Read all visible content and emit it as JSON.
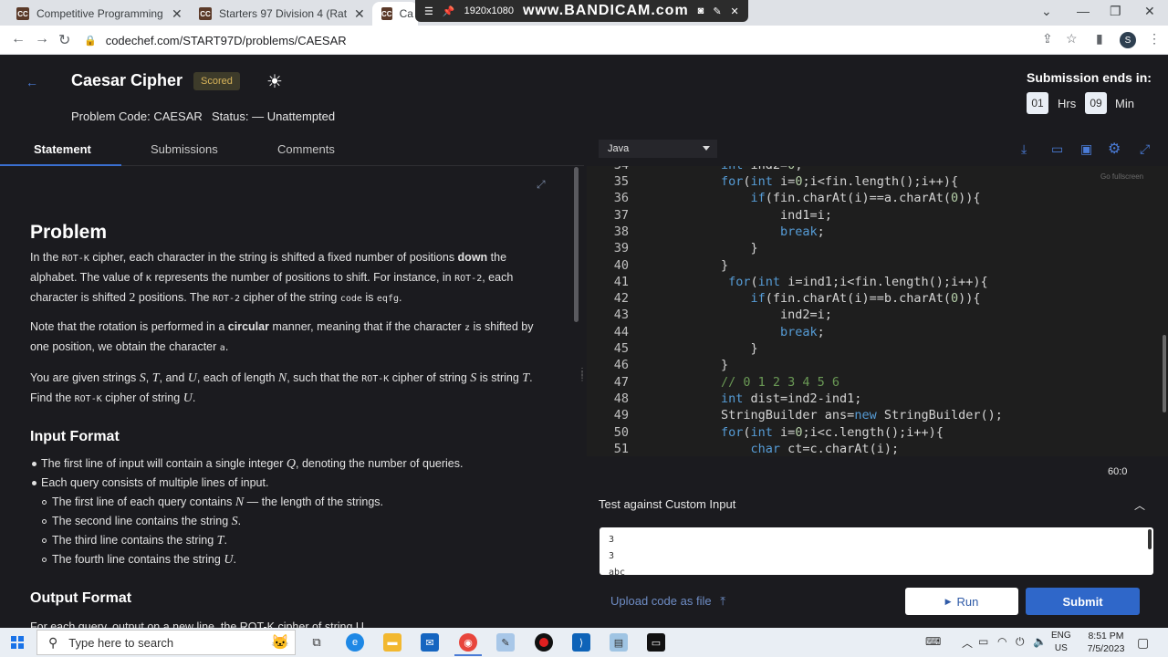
{
  "browser": {
    "tabs": [
      {
        "favicon": "CC",
        "title": "Competitive Programming and C",
        "close": "✕"
      },
      {
        "favicon": "CC",
        "title": "Starters 97 Division 4 (Rated) Co",
        "close": "✕"
      },
      {
        "favicon": "CC",
        "title": "Ca",
        "close": ""
      }
    ],
    "recorder": {
      "resolution": "1920x1080",
      "brand": "www.BANDICAM.com"
    },
    "url": "codechef.com/START97D/problems/CAESAR",
    "profile_initial": "S"
  },
  "header": {
    "title": "Caesar Cipher",
    "badge": "Scored",
    "problem_code": "Problem Code: CAESAR",
    "status": "Status: — Unattempted",
    "submission_label": "Submission ends in:",
    "hours": "01",
    "hours_unit": "Hrs",
    "minutes": "09",
    "minutes_unit": "Min"
  },
  "left_tabs": [
    "Statement",
    "Submissions",
    "Comments"
  ],
  "statement": {
    "problem_heading": "Problem",
    "input_heading": "Input Format",
    "output_heading": "Output Format",
    "output_partial": "For each query, output on a new line, the ROT-K cipher of string U."
  },
  "editor": {
    "language": "Java",
    "go_fullscreen": "Go fullscreen",
    "cursor": "60:0",
    "lines": [
      {
        "n": "35",
        "code": "for(int i=0;i<fin.length();i++){"
      },
      {
        "n": "36",
        "code": "    if(fin.charAt(i)==a.charAt(0)){"
      },
      {
        "n": "37",
        "code": "        ind1=i;"
      },
      {
        "n": "38",
        "code": "        break;"
      },
      {
        "n": "39",
        "code": "    }"
      },
      {
        "n": "40",
        "code": "}"
      },
      {
        "n": "41",
        "code": " for(int i=ind1;i<fin.length();i++){"
      },
      {
        "n": "42",
        "code": "    if(fin.charAt(i)==b.charAt(0)){"
      },
      {
        "n": "43",
        "code": "        ind2=i;"
      },
      {
        "n": "44",
        "code": "        break;"
      },
      {
        "n": "45",
        "code": "    }"
      },
      {
        "n": "46",
        "code": "}"
      },
      {
        "n": "47",
        "code": "// 0 1 2 3 4 5 6"
      },
      {
        "n": "48",
        "code": "int dist=ind2-ind1;"
      },
      {
        "n": "49",
        "code": "StringBuilder ans=new StringBuilder();"
      },
      {
        "n": "50",
        "code": "for(int i=0;i<c.length();i++){"
      },
      {
        "n": "51",
        "code": "    char ct=c.charAt(i);"
      }
    ]
  },
  "custom_input": {
    "heading": "Test against Custom Input",
    "lines": [
      "3",
      "3",
      "abc"
    ]
  },
  "footer": {
    "upload": "Upload code as file",
    "run": "Run",
    "submit": "Submit"
  },
  "taskbar": {
    "search_placeholder": "Type here to search",
    "lang_top": "ENG",
    "lang_bottom": "US",
    "time": "8:51 PM",
    "date": "7/5/2023"
  }
}
